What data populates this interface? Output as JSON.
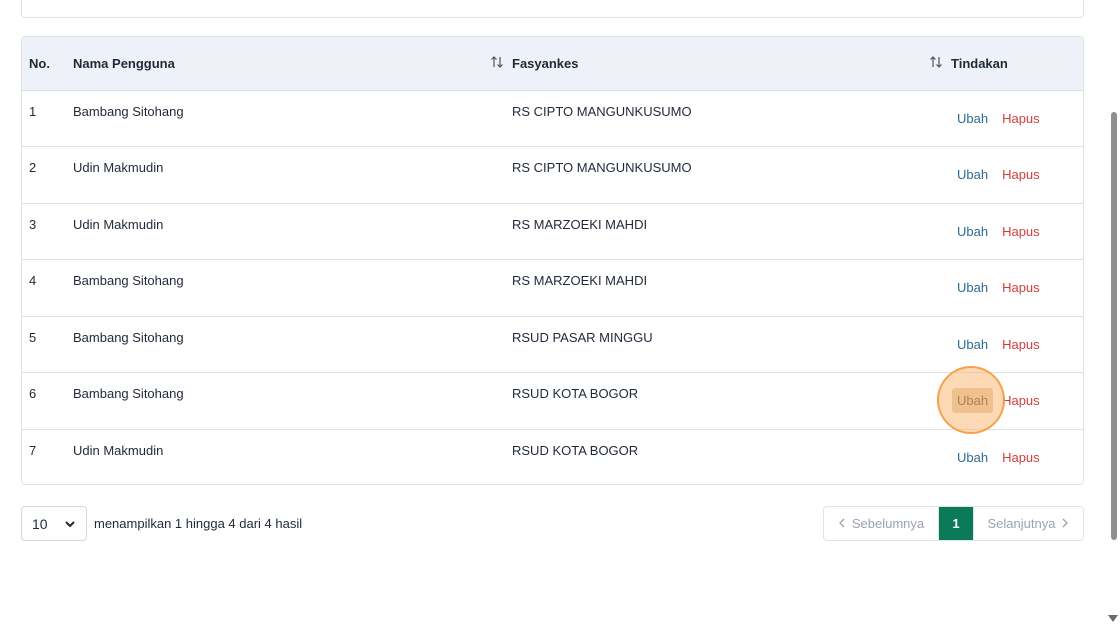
{
  "table": {
    "headers": {
      "no": "No.",
      "name": "Nama Pengguna",
      "facility": "Fasyankes",
      "actions": "Tindakan"
    },
    "sort_icon": "sort-arrows-icon",
    "rows": [
      {
        "no": "1",
        "name": "Bambang Sitohang",
        "facility": "RS CIPTO MANGUNKUSUMO",
        "edit": "Ubah",
        "delete": "Hapus"
      },
      {
        "no": "2",
        "name": "Udin Makmudin",
        "facility": "RS CIPTO MANGUNKUSUMO",
        "edit": "Ubah",
        "delete": "Hapus"
      },
      {
        "no": "3",
        "name": "Udin Makmudin",
        "facility": "RS MARZOEKI MAHDI",
        "edit": "Ubah",
        "delete": "Hapus"
      },
      {
        "no": "4",
        "name": "Bambang Sitohang",
        "facility": "RS MARZOEKI MAHDI",
        "edit": "Ubah",
        "delete": "Hapus"
      },
      {
        "no": "5",
        "name": "Bambang Sitohang",
        "facility": "RSUD PASAR MINGGU",
        "edit": "Ubah",
        "delete": "Hapus"
      },
      {
        "no": "6",
        "name": "Bambang Sitohang",
        "facility": "RSUD KOTA BOGOR",
        "edit": "Ubah",
        "delete": "Hapus"
      },
      {
        "no": "7",
        "name": "Udin Makmudin",
        "facility": "RSUD KOTA BOGOR",
        "edit": "Ubah",
        "delete": "Hapus"
      }
    ]
  },
  "pagination": {
    "page_size": "10",
    "info": "menampilkan 1 hingga 4 dari 4 hasil",
    "prev_label": "Sebelumnya",
    "next_label": "Selanjutnya",
    "current_page": "1"
  },
  "colors": {
    "accent": "#0b7a57",
    "edit_link": "#2f6b94",
    "delete_link": "#cf3e3e",
    "header_bg": "#eef2f8"
  }
}
